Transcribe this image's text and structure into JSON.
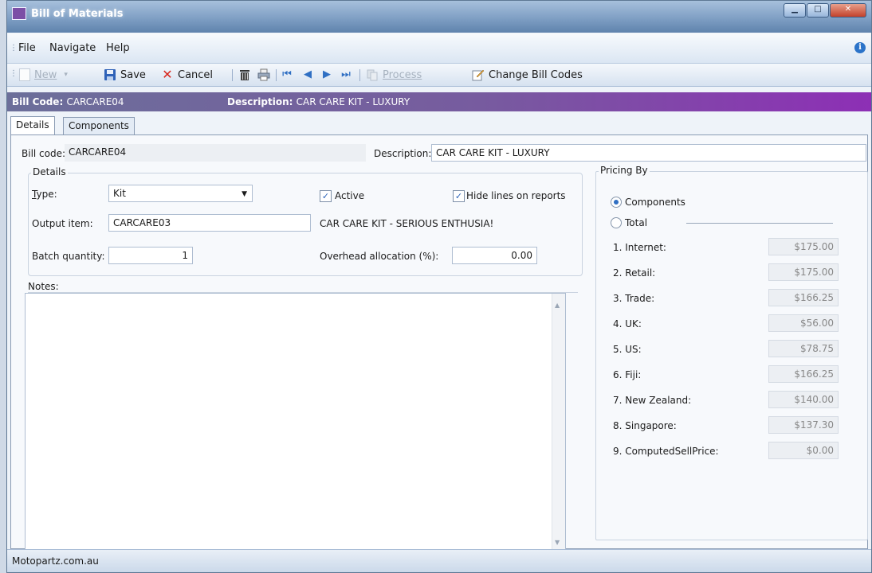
{
  "window": {
    "title": "Bill of Materials"
  },
  "menu": {
    "file": "File",
    "navigate": "Navigate",
    "help": "Help"
  },
  "toolbar": {
    "new_label": "New",
    "save_label": "Save",
    "cancel_label": "Cancel",
    "process_label": "Process",
    "change_bill_codes_label": "Change Bill Codes"
  },
  "header": {
    "bill_code_label": "Bill Code:",
    "bill_code_value": "CARCARE04",
    "description_label": "Description:",
    "description_value": "CAR CARE KIT - LUXURY"
  },
  "tabs": [
    {
      "label": "Details"
    },
    {
      "label": "Components"
    }
  ],
  "details": {
    "bill_code_label": "Bill code:",
    "bill_code_value": "CARCARE04",
    "description_label": "Description:",
    "description_value": "CAR CARE KIT - LUXURY",
    "group_title": "Details",
    "type_label": "Type:",
    "type_value": "Kit",
    "active_label": "Active",
    "active_checked": true,
    "hide_lines_label": "Hide lines on reports",
    "hide_lines_checked": true,
    "output_item_label": "Output item:",
    "output_item_value": "CARCARE03",
    "output_item_description": "CAR CARE KIT - SERIOUS ENTHUSIA!",
    "batch_quantity_label": "Batch quantity:",
    "batch_quantity_value": "1",
    "overhead_label": "Overhead allocation (%):",
    "overhead_value": "0.00",
    "notes_label": "Notes:",
    "notes_value": ""
  },
  "pricing": {
    "title": "Pricing By",
    "components_label": "Components",
    "total_label": "Total",
    "selected": "Components",
    "rows": [
      {
        "label": "1. Internet:",
        "value": "$175.00"
      },
      {
        "label": "2. Retail:",
        "value": "$175.00"
      },
      {
        "label": "3. Trade:",
        "value": "$166.25"
      },
      {
        "label": "4. UK:",
        "value": "$56.00"
      },
      {
        "label": "5. US:",
        "value": "$78.75"
      },
      {
        "label": "6. Fiji:",
        "value": "$166.25"
      },
      {
        "label": "7. New Zealand:",
        "value": "$140.00"
      },
      {
        "label": "8. Singapore:",
        "value": "$137.30"
      },
      {
        "label": "9. ComputedSellPrice:",
        "value": "$0.00"
      }
    ]
  },
  "status": {
    "text": "Motopartz.com.au"
  },
  "colors": {
    "header_gradient_start": "#6c6f9a",
    "header_gradient_end": "#8d2fb5",
    "accent": "#2f6fc3"
  }
}
